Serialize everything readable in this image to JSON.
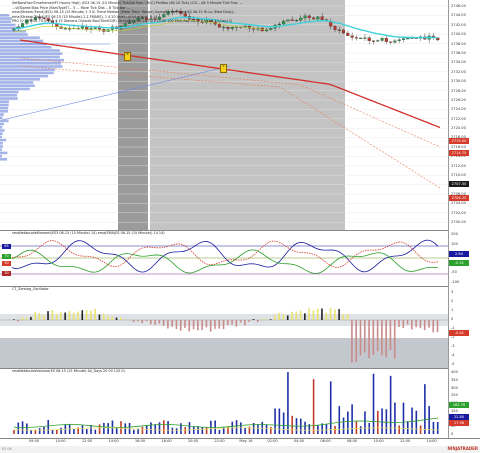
{
  "price_pane": {
    "header_lines": [
      "SetBarsFromTimeframe(MY Hourly High) (ES3 06-15 (15 Minute) Tick/Vol Frac. (HLC) PrcMax (60 24 Tick) LCS...  Alt 5 Minute Tick Frac. ...",
      "...vl/Stored Bias Price (BarsTypeTl...  5 ...  More Tick Dist...  8 Tick Bar ...",
      "ema(Stream-Trend)(E(S) 06-15 (15 Minute) 1 3 0) Trend Median (Meta Time: Range),SwingRange(Trend/ES 06-15 Hi-Lo (Med Daily)...",
      "ema(Stream-Trend)(ES 06-15 (15 Minute)-1-1 FMARS), 1 4 20 (RMS) (03/14/2017 4 15)",
      "PRG (0.25 0.01 70,0.35 ) 4.15 Stevens Outside Box(TrimES(R) Strength(1.00 21 0 21 13.00 100 Mid) Avg 3 1 2 3 5 (1 5 10 Cap) 1)"
    ],
    "y_ticks": [
      "2746.00",
      "2744.00",
      "2742.00",
      "2740.00",
      "2738.00",
      "2736.00",
      "2734.00",
      "2732.00",
      "2730.00",
      "2728.00",
      "2726.00",
      "2724.00",
      "2722.00",
      "2720.00",
      "2718.00",
      "2716.00",
      "2714.00",
      "2712.00",
      "2710.00",
      "2708.00",
      "2706.00",
      "2704.00",
      "2702.00",
      "2700.00"
    ],
    "price_labels": [
      {
        "text": "2719.00",
        "color": "#d43b2a"
      },
      {
        "text": "2714.75",
        "color": "#d43b2a"
      },
      {
        "text": "2707.50",
        "color": "#1b1b1b"
      },
      {
        "text": "2704.25",
        "color": "#d43b2a"
      }
    ],
    "markers": [
      "B",
      "S"
    ]
  },
  "osc_pane": {
    "header": "smaNetdoubleMoment(ES3 06-15 (15 Minute) 14)  ema(EMA(ES 06-15 (15 Minute)) 14 14)",
    "y_ticks": [
      "200",
      "100",
      "50",
      "0",
      "-50",
      "-100"
    ],
    "left_labels": [
      {
        "text": "85",
        "color": "#1a1aa0"
      },
      {
        "text": "70",
        "color": "#2ca02c"
      },
      {
        "text": "50",
        "color": "#d43b2a"
      },
      {
        "text": "30",
        "color": "#b02828"
      }
    ],
    "price_labels": [
      {
        "text": "2.64",
        "color": "#1a1aa0"
      },
      {
        "text": "-0.15",
        "color": "#2ca02c"
      }
    ]
  },
  "zerolag_pane": {
    "header": "CT_Zerolag_Oscillator",
    "y_ticks": [
      "3",
      "2",
      "1",
      "0",
      "-1",
      "-2",
      "-3",
      "-4",
      "-5"
    ],
    "price_labels": [
      {
        "text": "-0.24",
        "color": "#d43b2a"
      }
    ]
  },
  "volume_pane": {
    "header": "smaNetdoubleVolume(ES 06-15 (15 Minute) All_Days 20 00 120 0)",
    "y_ticks": [
      "400",
      "350",
      "300",
      "250",
      "200",
      "150",
      "100",
      "50",
      "0"
    ],
    "price_labels": [
      {
        "text": "182.70",
        "color": "#2ca02c"
      },
      {
        "text": "22.80",
        "color": "#1a1aa0"
      },
      {
        "text": "17.98",
        "color": "#d43b2a"
      }
    ]
  },
  "x_axis": [
    "09:00",
    "10:00",
    "12:00",
    "14:00",
    "16:00",
    "18:00",
    "20:00",
    "22:00",
    "May 16",
    "02:00",
    "04:00",
    "06:00",
    "08:00",
    "10:00",
    "12:00",
    "14:00"
  ],
  "footer": {
    "brand": "NINJATRADER",
    "timestamp": "ES 06"
  },
  "colors": {
    "up": "#2d9a4c",
    "down": "#b73a2e",
    "ema_cyan": "#3fd1d9",
    "ema_red": "#d2302a",
    "shade": "#7a7a7a",
    "profile": "#5a76d6"
  }
}
